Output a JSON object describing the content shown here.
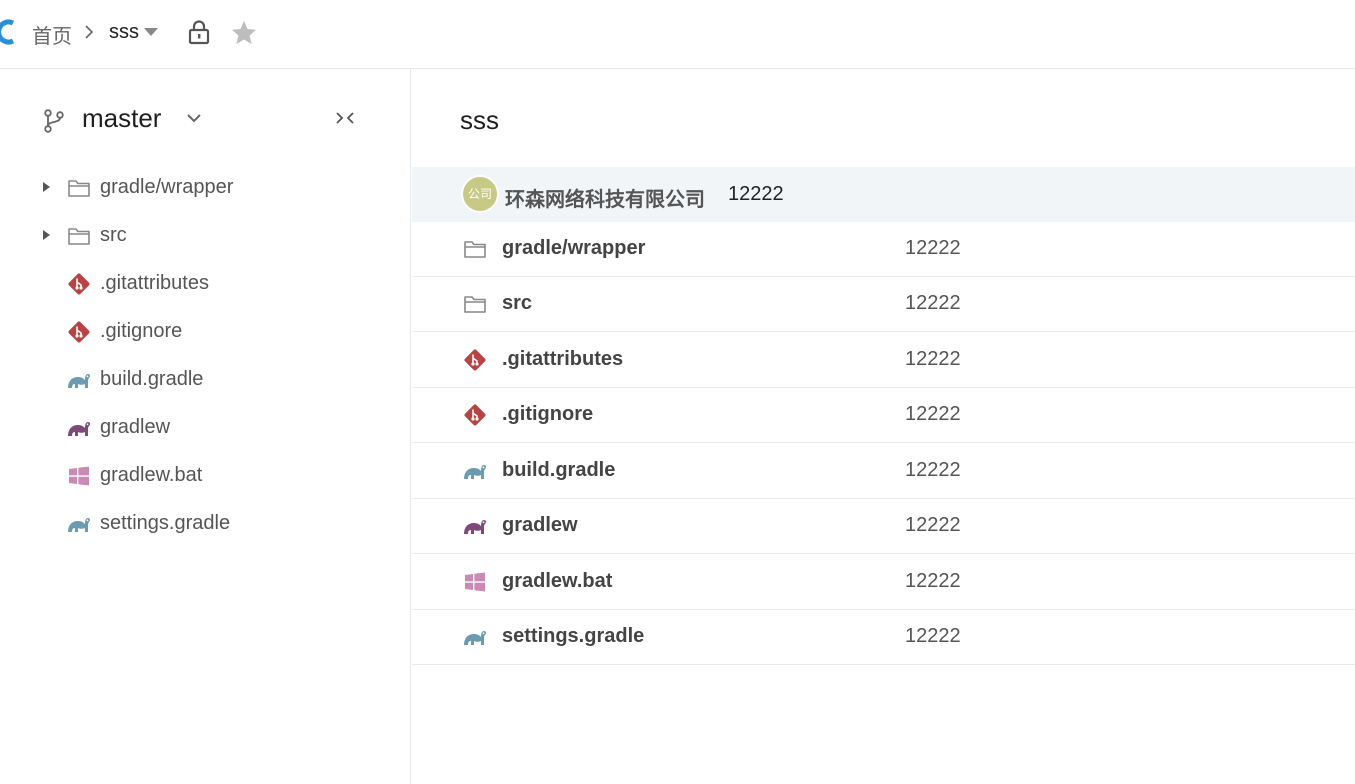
{
  "colors": {
    "git": "#b84343",
    "gradle_blue": "#6a9bb0",
    "gradle_purple": "#7d4b7a",
    "windows": "#c98bb3",
    "folder": "#888888",
    "avatar_bg": "#c7ca85",
    "commit_bar_bg": "#f1f5f8",
    "logo": "#2a8fd4"
  },
  "header": {
    "home_label": "首页",
    "repo_label": "sss"
  },
  "sidebar": {
    "branch": "master",
    "items": [
      {
        "label": "gradle/wrapper",
        "icon": "folder-icon",
        "expandable": true
      },
      {
        "label": "src",
        "icon": "folder-icon",
        "expandable": true
      },
      {
        "label": ".gitattributes",
        "icon": "git-icon",
        "expandable": false
      },
      {
        "label": ".gitignore",
        "icon": "git-icon",
        "expandable": false
      },
      {
        "label": "build.gradle",
        "icon": "gradle-icon",
        "expandable": false
      },
      {
        "label": "gradlew",
        "icon": "gradlew-icon",
        "expandable": false
      },
      {
        "label": "gradlew.bat",
        "icon": "windows-icon",
        "expandable": false
      },
      {
        "label": "settings.gradle",
        "icon": "gradle-icon",
        "expandable": false
      }
    ]
  },
  "main": {
    "title": "sss",
    "latest_commit": {
      "avatar_text": "公司",
      "author": "环森网络科技有限公司",
      "message": "12222"
    },
    "files": [
      {
        "name": "gradle/wrapper",
        "icon": "folder-icon",
        "commit": "12222"
      },
      {
        "name": "src",
        "icon": "folder-icon",
        "commit": "12222"
      },
      {
        "name": ".gitattributes",
        "icon": "git-icon",
        "commit": "12222"
      },
      {
        "name": ".gitignore",
        "icon": "git-icon",
        "commit": "12222"
      },
      {
        "name": "build.gradle",
        "icon": "gradle-icon",
        "commit": "12222"
      },
      {
        "name": "gradlew",
        "icon": "gradlew-icon",
        "commit": "12222"
      },
      {
        "name": "gradlew.bat",
        "icon": "windows-icon",
        "commit": "12222"
      },
      {
        "name": "settings.gradle",
        "icon": "gradle-icon",
        "commit": "12222"
      }
    ]
  }
}
